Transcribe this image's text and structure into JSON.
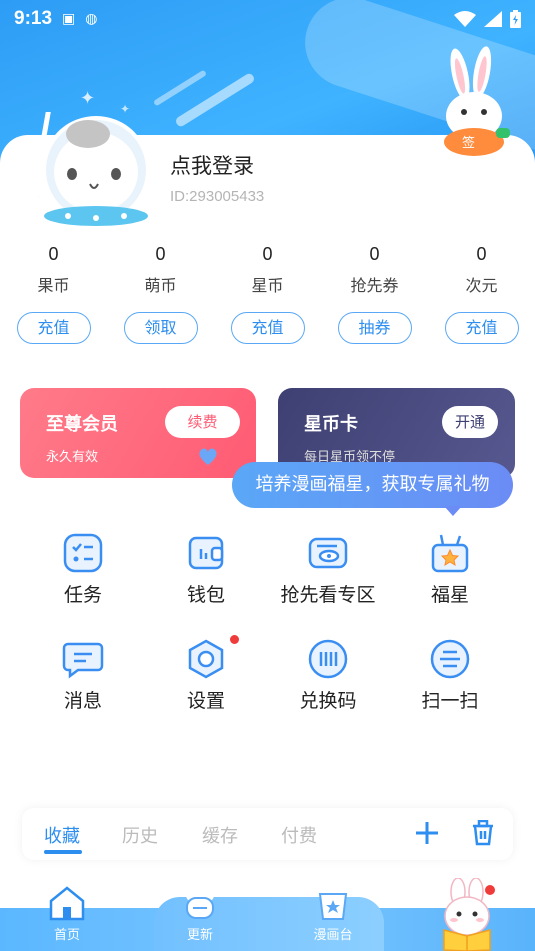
{
  "status_bar": {
    "time": "9:13"
  },
  "profile": {
    "login_text": "点我登录",
    "user_id": "ID:293005433"
  },
  "stats": [
    {
      "value": "0",
      "label": "果币",
      "button": "充值"
    },
    {
      "value": "0",
      "label": "萌币",
      "button": "领取"
    },
    {
      "value": "0",
      "label": "星币",
      "button": "充值"
    },
    {
      "value": "0",
      "label": "抢先券",
      "button": "抽券"
    },
    {
      "value": "0",
      "label": "次元",
      "button": "充值"
    }
  ],
  "vip_card": {
    "title": "至尊会员",
    "subtitle": "永久有效",
    "button": "续费"
  },
  "star_card": {
    "title": "星币卡",
    "subtitle": "每日星币领不停",
    "button": "开通"
  },
  "tooltip": "培养漫画福星，获取专属礼物",
  "menu": [
    {
      "label": "任务",
      "icon": "task-list-icon"
    },
    {
      "label": "钱包",
      "icon": "wallet-icon"
    },
    {
      "label": "抢先看专区",
      "icon": "ticket-eye-icon"
    },
    {
      "label": "福星",
      "icon": "gift-star-icon"
    },
    {
      "label": "消息",
      "icon": "message-bubble-icon"
    },
    {
      "label": "设置",
      "icon": "settings-hexagon-icon"
    },
    {
      "label": "兑换码",
      "icon": "redeem-code-icon"
    },
    {
      "label": "扫一扫",
      "icon": "scan-icon"
    }
  ],
  "fav_tabs": [
    "收藏",
    "历史",
    "缓存",
    "付费"
  ],
  "bottom_nav": [
    {
      "label": "首页",
      "icon": "home-icon"
    },
    {
      "label": "更新",
      "icon": "chef-bread-icon"
    },
    {
      "label": "漫画台",
      "icon": "comic-star-icon"
    }
  ],
  "colors": {
    "primary": "#2d8ef0",
    "vip": "#ff5b73",
    "star_card": "#3e3f72",
    "badge": "#f03b3b"
  }
}
